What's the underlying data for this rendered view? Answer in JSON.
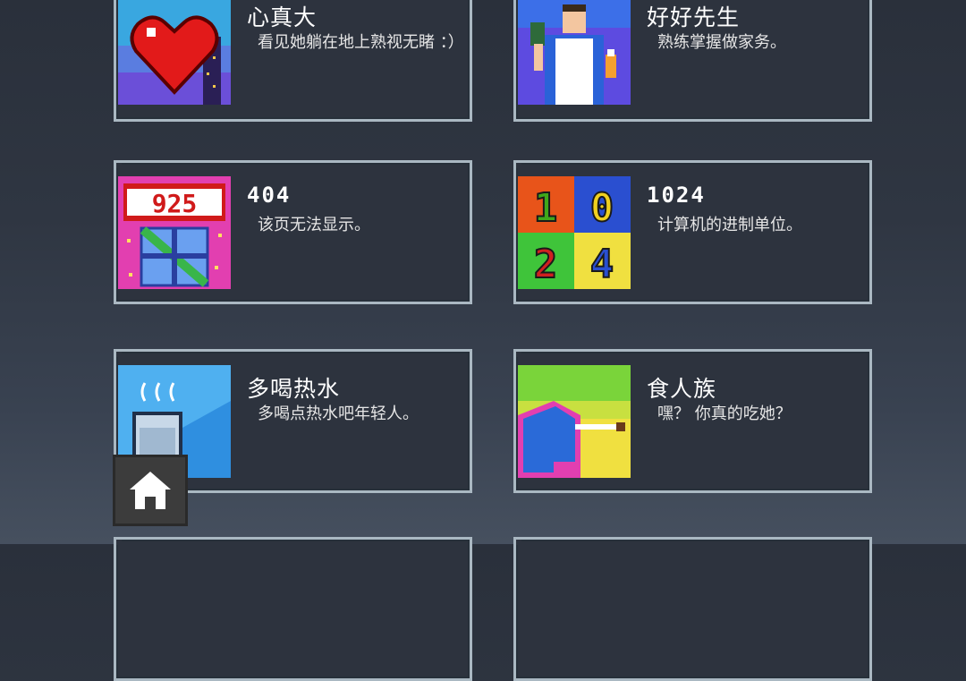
{
  "achievements": [
    {
      "title": "心真大",
      "desc": "看见她躺在地上熟视无睹 ：）",
      "icon": "heart-icon"
    },
    {
      "title": "好好先生",
      "desc": "熟练掌握做家务。",
      "icon": "housekeeper-icon"
    },
    {
      "title": "404",
      "desc": "该页无法显示。",
      "icon": "gift-counter-icon",
      "counter": "925"
    },
    {
      "title": "1024",
      "desc": "计算机的进制单位。",
      "icon": "number-grid-icon",
      "digits": [
        "1",
        "0",
        "2",
        "4"
      ]
    },
    {
      "title": "多喝热水",
      "desc": "多喝点热水吧年轻人。",
      "icon": "hot-water-cup-icon"
    },
    {
      "title": "食人族",
      "desc": "嘿？ 你真的吃她？",
      "icon": "cannibal-icon"
    }
  ],
  "nav": {
    "home_icon": "home-icon"
  }
}
